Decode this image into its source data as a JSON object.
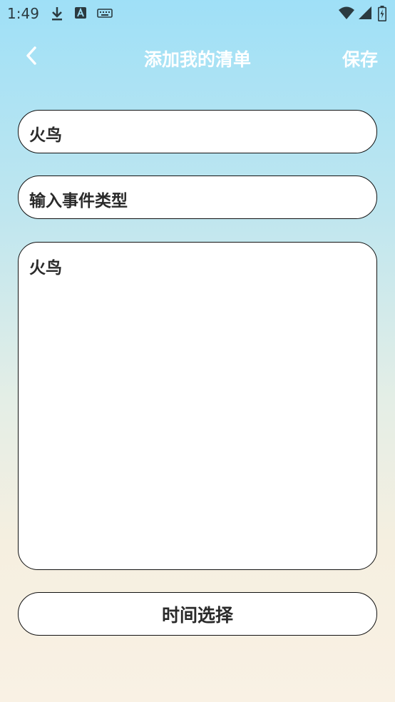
{
  "status_bar": {
    "time": "1:49",
    "icons": [
      "download-icon",
      "a-icon",
      "keyboard-icon",
      "wifi-icon",
      "signal-icon",
      "battery-icon"
    ]
  },
  "header": {
    "title": "添加我的清单",
    "save_label": "保存",
    "back_icon": "chevron-left-icon"
  },
  "form": {
    "name_value": "火鸟",
    "type_placeholder": "输入事件类型",
    "content_value": "火鸟",
    "time_button_label": "时间选择"
  },
  "colors": {
    "gradient_top": "#9fe0f7",
    "gradient_bottom": "#f9f1e4",
    "header_text": "#ffffff",
    "border": "#111111"
  }
}
